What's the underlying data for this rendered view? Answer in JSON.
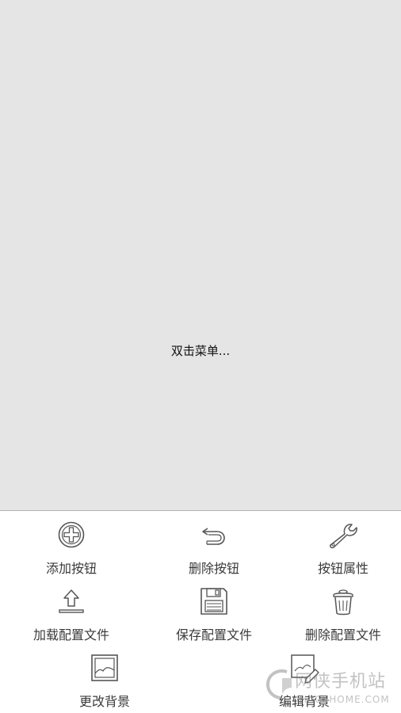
{
  "canvas": {
    "hint": "双击菜单..."
  },
  "menu": {
    "items": [
      {
        "label": "添加按钮",
        "icon": "add-circle-icon"
      },
      {
        "label": "删除按钮",
        "icon": "undo-icon"
      },
      {
        "label": "按钮属性",
        "icon": "wrench-icon"
      },
      {
        "label": "加载配置文件",
        "icon": "upload-icon"
      },
      {
        "label": "保存配置文件",
        "icon": "save-floppy-icon"
      },
      {
        "label": "删除配置文件",
        "icon": "trash-icon"
      },
      {
        "label": "更改背景",
        "icon": "image-icon"
      },
      {
        "label": "编辑背景",
        "icon": "edit-image-icon"
      }
    ]
  },
  "watermark": {
    "text": "网侠手机站",
    "sub": "HACKHOME.COM"
  },
  "colors": {
    "canvas_bg": "#e5e5e5",
    "menu_bg": "#ffffff",
    "label_text": "#3a3a3a"
  }
}
